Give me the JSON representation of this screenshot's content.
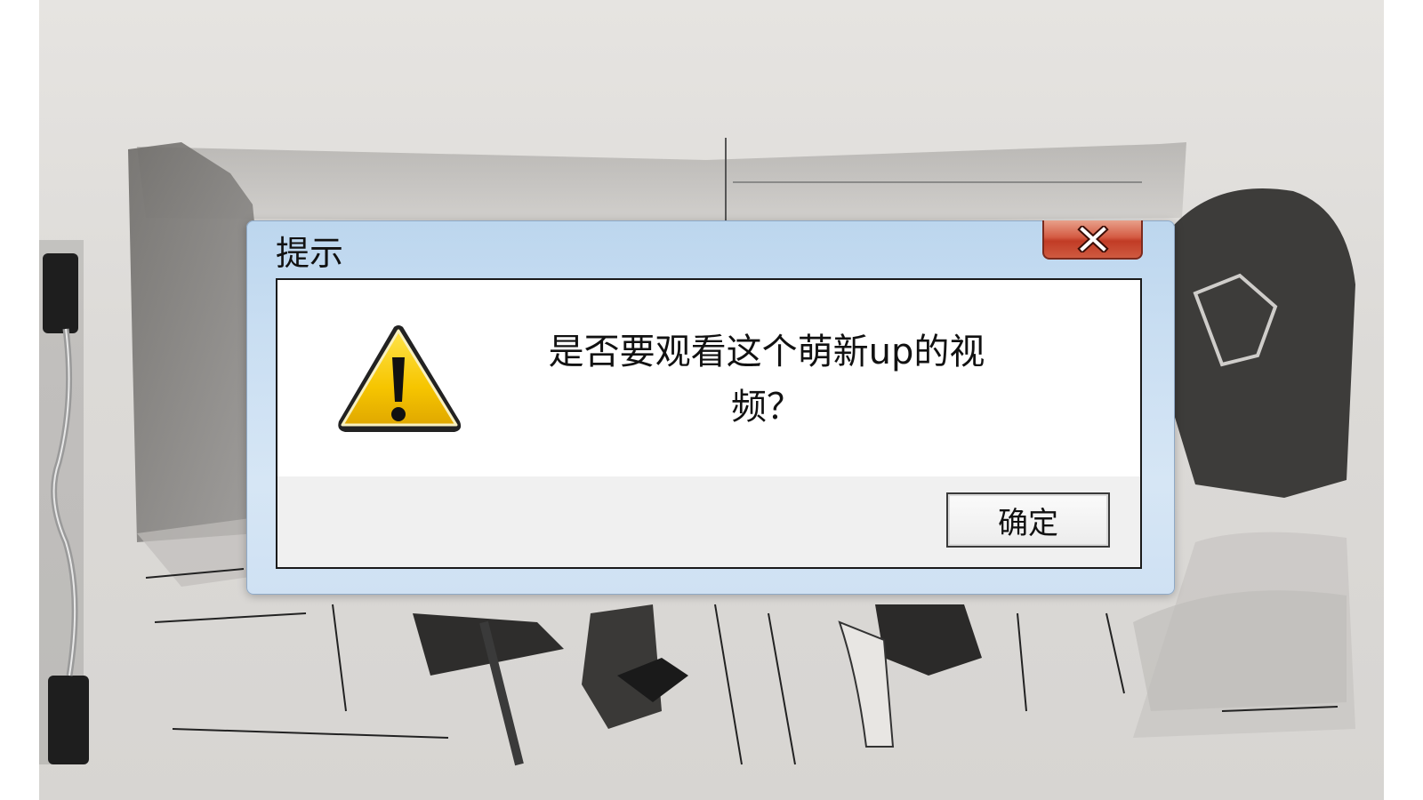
{
  "dialog": {
    "title": "提示",
    "message_line1": "是否要观看这个萌新up的视",
    "message_line2": "频？",
    "ok_label": "确定",
    "close_glyph": "X"
  },
  "colors": {
    "title_bar": "#c9def2",
    "close_button": "#c13b25",
    "warning_fill": "#f6c500",
    "content_bg": "#ffffff",
    "button_bar_bg": "#f0f0f0"
  },
  "icons": {
    "close": "close-icon",
    "warning": "warning-icon"
  }
}
